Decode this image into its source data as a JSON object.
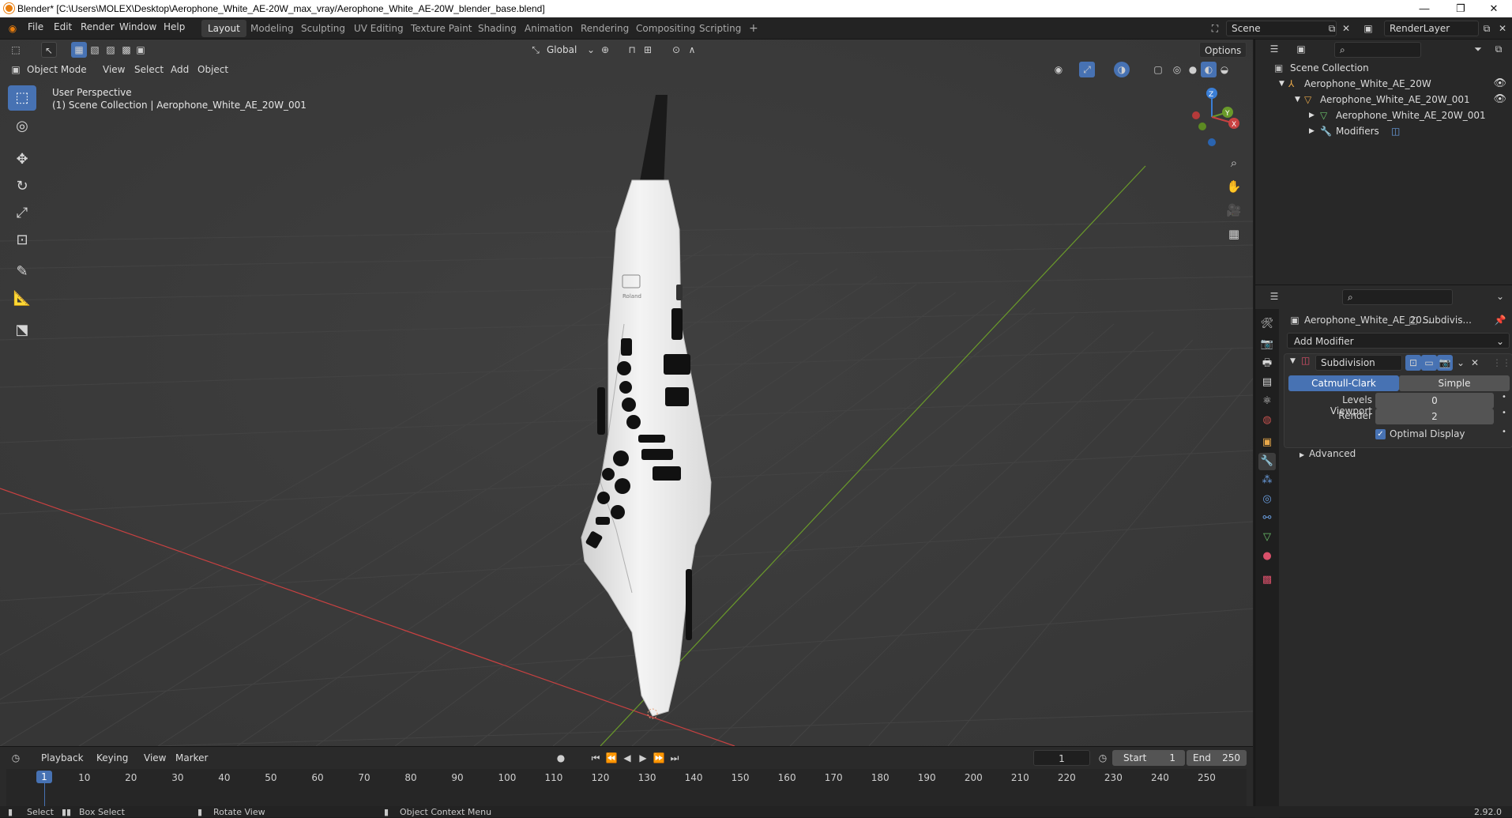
{
  "titlebar": {
    "title": "Blender* [C:\\Users\\MOLEX\\Desktop\\Aerophone_White_AE-20W_max_vray/Aerophone_White_AE-20W_blender_base.blend]",
    "minimize": "—",
    "maximize": "❐",
    "close": "✕"
  },
  "menu": [
    "File",
    "Edit",
    "Render",
    "Window",
    "Help"
  ],
  "workspaces": {
    "tabs": [
      "Layout",
      "Modeling",
      "Sculpting",
      "UV Editing",
      "Texture Paint",
      "Shading",
      "Animation",
      "Rendering",
      "Compositing",
      "Scripting"
    ],
    "add": "+",
    "active": "Layout"
  },
  "scene": {
    "scene_name": "Scene",
    "view_layer": "RenderLayer"
  },
  "viewport_header": {
    "transform_orientation": "Global",
    "options": "Options",
    "mode": "Object Mode",
    "menus": [
      "View",
      "Select",
      "Add",
      "Object"
    ]
  },
  "viewport": {
    "view_name": "User Perspective",
    "collection_info": "(1) Scene Collection | Aerophone_White_AE_20W_001",
    "brand_text": "Roland",
    "gizmo": {
      "z": "Z",
      "y": "Y",
      "x": "X"
    }
  },
  "outliner": {
    "root": "Scene Collection",
    "items": [
      {
        "label": "Aerophone_White_AE_20W",
        "level": 1
      },
      {
        "label": "Aerophone_White_AE_20W_001",
        "level": 2
      },
      {
        "label": "Aerophone_White_AE_20W_001",
        "level": 3
      },
      {
        "label": "Modifiers",
        "level": 3
      }
    ]
  },
  "properties": {
    "object_name": "Aerophone_White_AE_20...",
    "modifier_short": "Subdivis...",
    "add_modifier": "Add Modifier",
    "modifier": {
      "name": "Subdivision",
      "type_options": [
        "Catmull-Clark",
        "Simple"
      ],
      "active_type": "Catmull-Clark",
      "levels_viewport_label": "Levels Viewport",
      "levels_viewport": "0",
      "render_label": "Render",
      "render": "2",
      "optimal_display_label": "Optimal Display",
      "optimal_display": true,
      "advanced_label": "Advanced"
    }
  },
  "timeline": {
    "menus": [
      "Playback",
      "Keying",
      "View",
      "Marker"
    ],
    "current_frame": "1",
    "start_label": "Start",
    "start": "1",
    "end_label": "End",
    "end": "250",
    "ticks": [
      "1",
      "10",
      "20",
      "30",
      "40",
      "50",
      "60",
      "70",
      "80",
      "90",
      "100",
      "110",
      "120",
      "130",
      "140",
      "150",
      "160",
      "170",
      "180",
      "190",
      "200",
      "210",
      "220",
      "230",
      "240",
      "250"
    ]
  },
  "statusbar": {
    "select": "Select",
    "box_select": "Box Select",
    "rotate_view": "Rotate View",
    "context_menu": "Object Context Menu",
    "version": "2.92.0"
  },
  "colors": {
    "accent": "#4772b3",
    "x_axis": "#c84141",
    "y_axis": "#6a9a2a",
    "z_axis": "#3a7ed6",
    "blender_orange": "#e87d0d"
  }
}
